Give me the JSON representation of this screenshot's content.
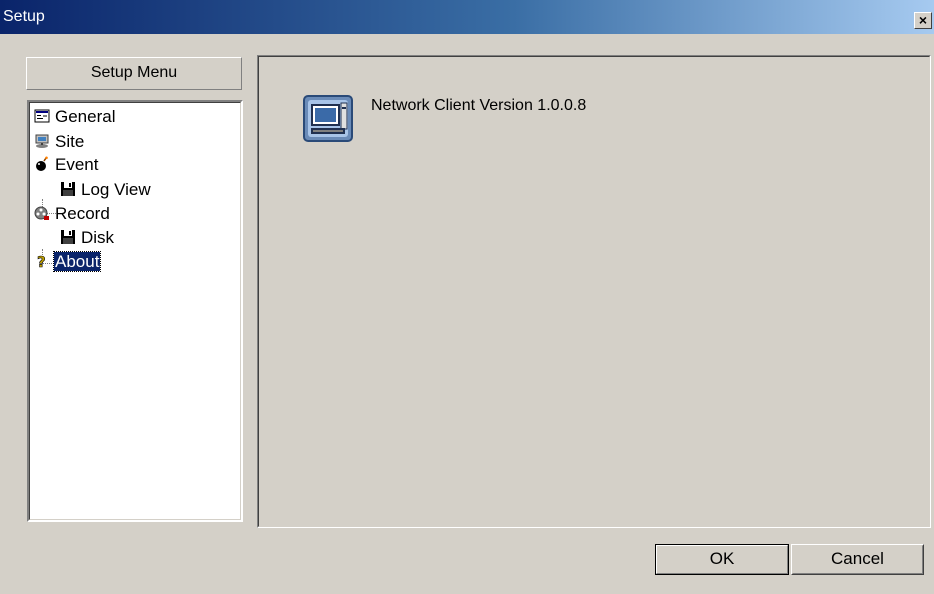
{
  "window": {
    "title": "Setup",
    "close_label": "×"
  },
  "setup_menu": {
    "label": "Setup Menu"
  },
  "tree": {
    "general": "General",
    "site": "Site",
    "event": "Event",
    "log_view": "Log View",
    "record": "Record",
    "disk": "Disk",
    "about": "About"
  },
  "about_panel": {
    "version_text": "Network Client Version 1.0.0.8"
  },
  "buttons": {
    "ok": "OK",
    "cancel": "Cancel"
  },
  "icons": {
    "general": "general-settings-icon",
    "site": "site-computer-icon",
    "event": "event-bomb-icon",
    "log_view": "floppy-disk-icon",
    "record": "record-film-icon",
    "disk": "floppy-disk-icon",
    "about": "question-mark-icon",
    "app": "network-client-icon"
  },
  "colors": {
    "title_start": "#0a246a",
    "title_end": "#a6caf0",
    "selection": "#0a246a",
    "face": "#d4d0c8"
  }
}
